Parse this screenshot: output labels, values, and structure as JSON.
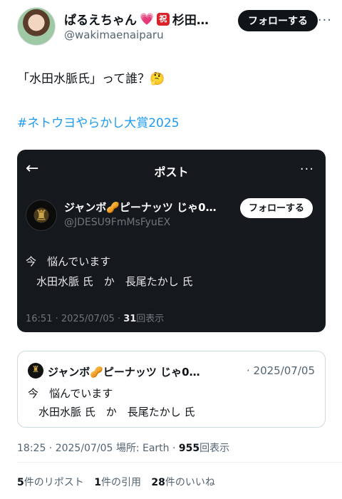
{
  "author": {
    "display_name": "ぱるえちゃん",
    "name_suffix": "杉田…",
    "handle": "@wakimaenaiparu",
    "badge_icon": "heart-icon",
    "badge_icon2": "celebrate-icon",
    "badge2_text": "祝",
    "follow_label": "フォローする",
    "more_icon": "···"
  },
  "tweet": {
    "text": "「水田水脈氏」って誰？🤔",
    "hashtag": "#ネトウヨやらかし大賞2025"
  },
  "embedded_screenshot": {
    "back_icon": "←",
    "title": "ポスト",
    "more_icon": "···",
    "name": "ジャンボ🥜ピーナッツ じゃ0…",
    "handle": "@JDESU9FmMsFyuEX",
    "follow_label": "フォローする",
    "line1": "今　悩んでいます",
    "line2": "　水田水脈 氏　か　長尾たかし 氏",
    "time": "16:51 · 2025/07/05 · ",
    "views_count": "31",
    "views_label": "回表示"
  },
  "quote": {
    "name": "ジャンボ🥜ピーナッツ じゃ0…",
    "date": "· 2025/07/05",
    "line1": "今　悩んでいます",
    "line2": "　水田水脈 氏　か　長尾たかし 氏"
  },
  "meta": {
    "time": "18:25 · 2025/07/05 場所: Earth · ",
    "views_count": "955",
    "views_label": "回表示"
  },
  "stats": {
    "reposts_count": "5",
    "reposts_label": "件のリポスト",
    "quotes_count": "1",
    "quotes_label": "件の引用",
    "likes_count": "28",
    "likes_label": "件のいいね"
  },
  "colors": {
    "accent": "#1d9bf0",
    "dark_card": "#15181c",
    "text": "#0f1419",
    "muted": "#536471"
  }
}
